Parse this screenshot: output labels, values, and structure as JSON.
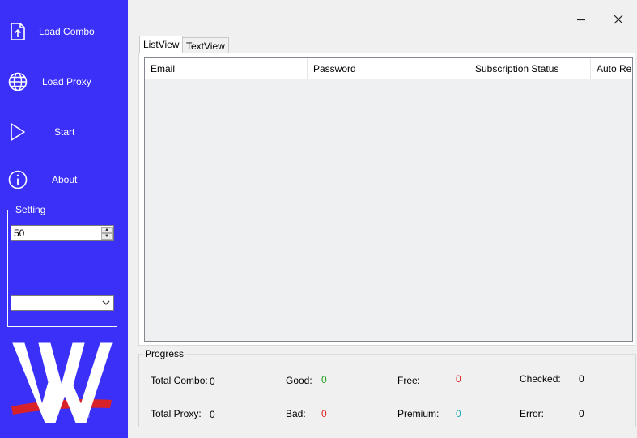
{
  "sidebar": {
    "items": [
      {
        "label": "Load Combo",
        "icon": "upload-file-icon"
      },
      {
        "label": "Load Proxy",
        "icon": "globe-icon"
      },
      {
        "label": "Start",
        "icon": "play-icon"
      },
      {
        "label": "About",
        "icon": "info-icon"
      }
    ],
    "setting": {
      "legend": "Setting",
      "threads_value": "50",
      "dropdown_value": ""
    },
    "logo": "wwe-logo"
  },
  "window": {
    "minimize_icon": "minimize-icon",
    "close_icon": "close-icon"
  },
  "tabs": [
    {
      "label": "ListView",
      "active": true
    },
    {
      "label": "TextView",
      "active": false
    }
  ],
  "list": {
    "columns": [
      "Email",
      "Password",
      "Subscription Status",
      "Auto Rer"
    ]
  },
  "progress": {
    "legend": "Progress",
    "stats": {
      "total_combo": {
        "label": "Total Combo:",
        "value": "0"
      },
      "total_proxy": {
        "label": "Total Proxy:",
        "value": "0"
      },
      "good": {
        "label": "Good:",
        "value": "0"
      },
      "bad": {
        "label": "Bad:",
        "value": "0"
      },
      "free": {
        "label": "Free:",
        "value": "0"
      },
      "premium": {
        "label": "Premium:",
        "value": "0"
      },
      "checked": {
        "label": "Checked:",
        "value": "0"
      },
      "error": {
        "label": "Error:",
        "value": "0"
      }
    }
  },
  "colors": {
    "sidebar_bg": "#3b30f7",
    "good": "#1a9e1a",
    "bad": "#e02020",
    "free": "#e02020",
    "premium": "#17a8b8",
    "neutral": "#000000"
  }
}
